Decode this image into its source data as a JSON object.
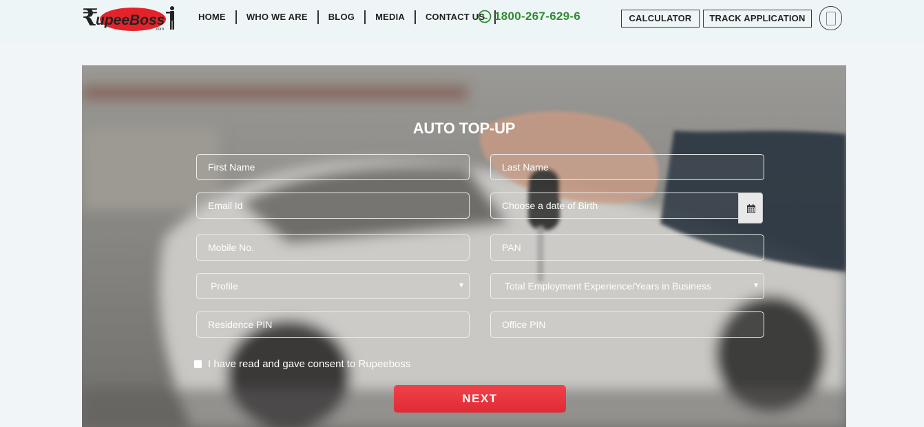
{
  "logo": {
    "text": "upeeBoss",
    "suffix": ".com"
  },
  "nav": {
    "items": [
      "HOME",
      "WHO WE ARE",
      "BLOG",
      "MEDIA",
      "CONTACT US"
    ]
  },
  "phone": {
    "number": "1800-267-629-6"
  },
  "header_buttons": {
    "calculator": "CALCULATOR",
    "track": "TRACK APPLICATION"
  },
  "form": {
    "title": "AUTO TOP-UP",
    "first_name": "First Name",
    "last_name": "Last Name",
    "email": "Email Id",
    "dob": "Choose a date of Birth",
    "mobile": "Mobile No.",
    "pan": "PAN",
    "profile": "Profile",
    "experience": "Total Employment Experience/Years in Business",
    "residence_pin": "Residence PIN",
    "office_pin": "Office PIN",
    "consent": "I have read and gave consent to Rupeeboss",
    "next": "NEXT"
  },
  "colors": {
    "brand_red": "#e8343c",
    "phone_green": "#2e8b2e"
  }
}
